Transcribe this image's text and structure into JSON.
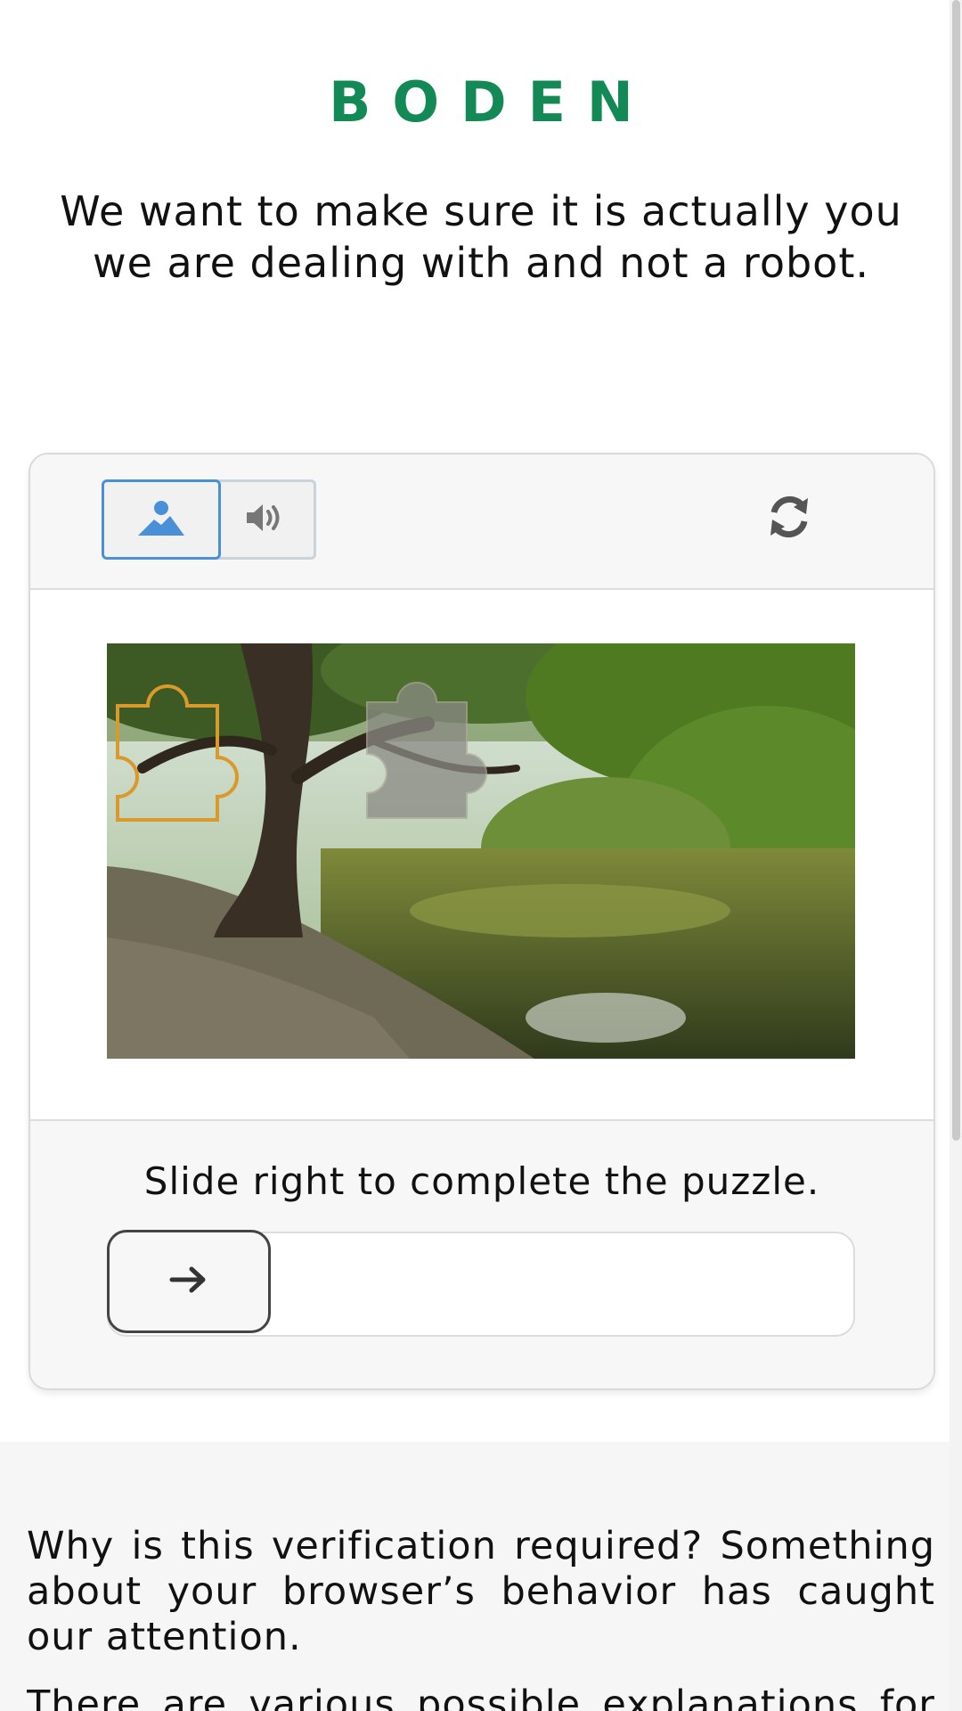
{
  "brand": {
    "logo_text": "BODEN",
    "color": "#138a55"
  },
  "intro_text": "We want to make sure it is actually you we are dealing with and not a robot.",
  "captcha": {
    "tabs": [
      {
        "icon": "image-icon",
        "selected": true
      },
      {
        "icon": "speaker-icon",
        "selected": false
      }
    ],
    "refresh_icon": "refresh-icon",
    "instruction": "Slide right to complete the puzzle.",
    "slider_icon": "arrow-right-icon",
    "slider_progress": 0
  },
  "footer": {
    "why_text": "Why is this verification required? Something about your browser’s behavior has caught our attention.",
    "more_text": "There are various possible explanations for this"
  },
  "colors": {
    "accent": "#4a90d9",
    "puzzle_outline": "#d99a2b"
  }
}
